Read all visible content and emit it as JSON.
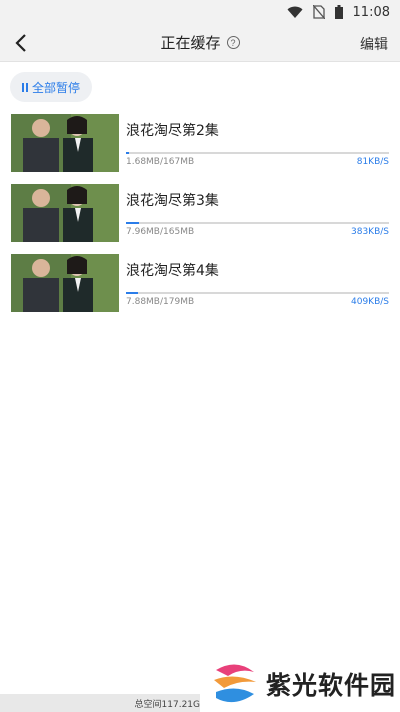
{
  "status_bar": {
    "time": "11:08"
  },
  "header": {
    "title": "正在缓存",
    "help_icon": "question-circle-icon",
    "edit_label": "编辑"
  },
  "pause_all": {
    "label": "全部暂停"
  },
  "downloads": [
    {
      "title": "浪花淘尽第2集",
      "size": "1.68MB/167MB",
      "speed": "81KB/S",
      "progress": 0.01
    },
    {
      "title": "浪花淘尽第3集",
      "size": "7.96MB/165MB",
      "speed": "383KB/S",
      "progress": 0.048
    },
    {
      "title": "浪花淘尽第4集",
      "size": "7.88MB/179MB",
      "speed": "409KB/S",
      "progress": 0.044
    }
  ],
  "footer": {
    "storage_text": "总空间117.21G"
  },
  "watermark": {
    "text": "紫光软件园"
  },
  "colors": {
    "accent": "#2b7de9",
    "header_bg": "#f2f2f2"
  }
}
